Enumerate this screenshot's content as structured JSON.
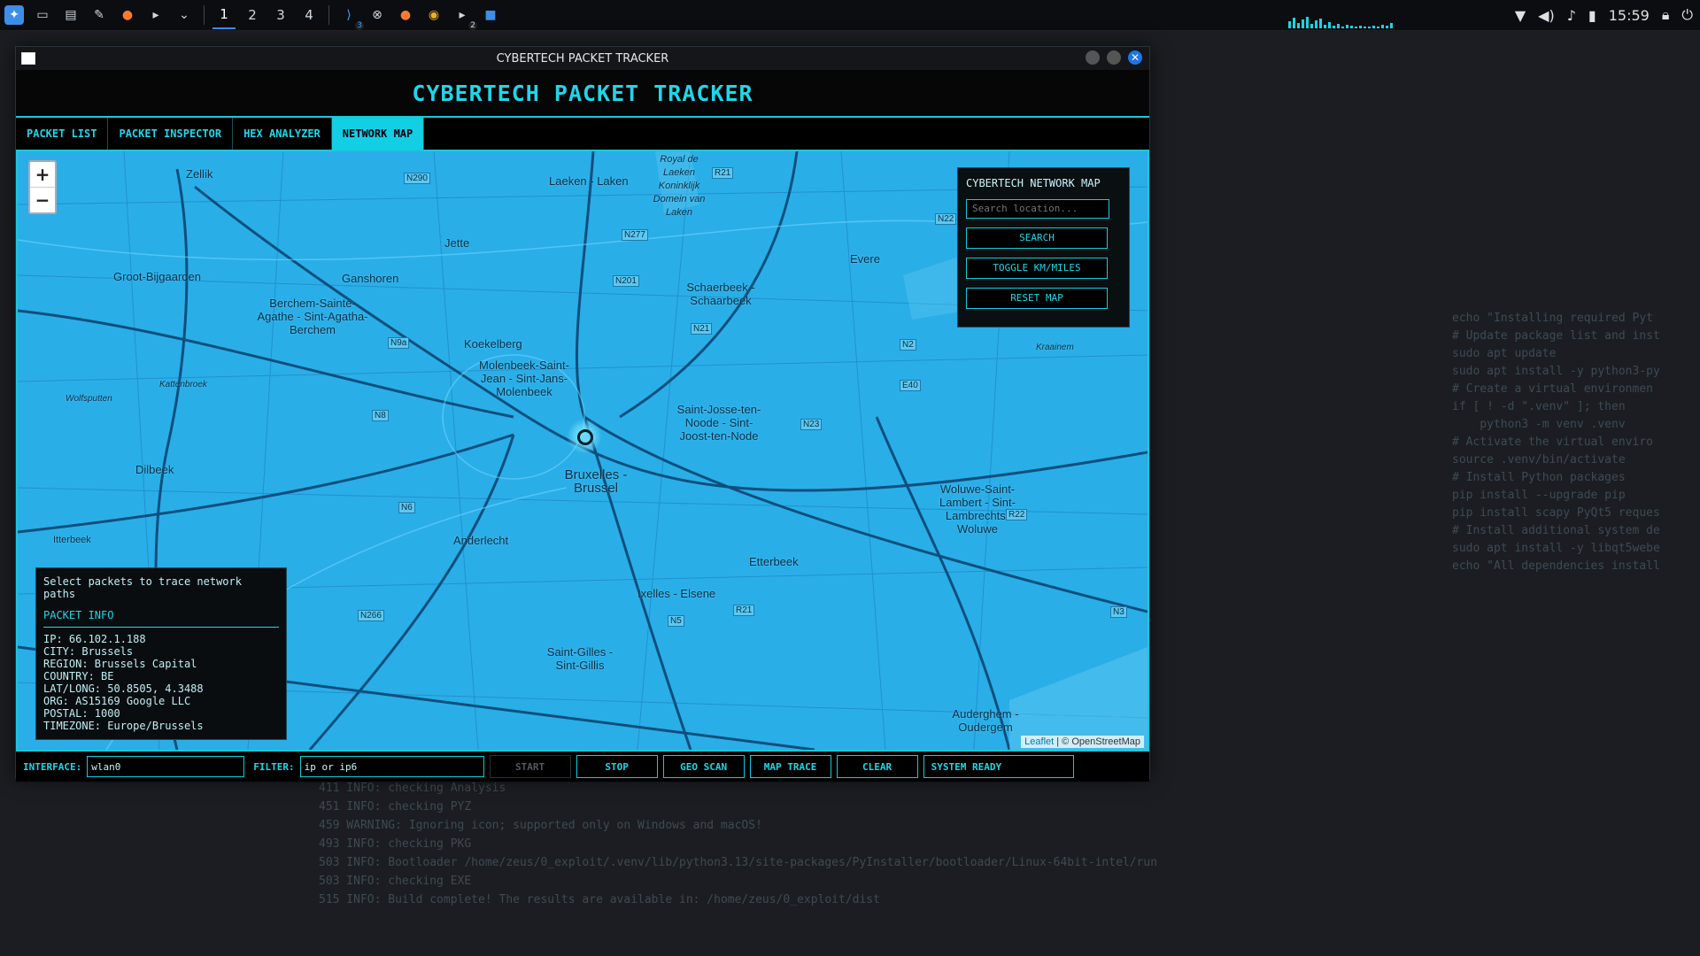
{
  "taskbar": {
    "workspaces": [
      "1",
      "2",
      "3",
      "4"
    ],
    "clock": "15:59",
    "badges": {
      "vscode": "3",
      "terminal": "2"
    }
  },
  "window": {
    "title": "CYBERTECH PACKET TRACKER",
    "app_title": "CYBERTECH PACKET TRACKER",
    "tabs": [
      "PACKET LIST",
      "PACKET INSPECTOR",
      "HEX ANALYZER",
      "NETWORK MAP"
    ],
    "active_tab": "NETWORK MAP"
  },
  "map": {
    "zoom_in": "+",
    "zoom_out": "−",
    "labels": [
      "Zellik",
      "Laeken - Laken",
      "Royal de Laeken Koninklijk Domein van Laken",
      "Jette",
      "Groot-Bijgaarden",
      "Ganshoren",
      "Berchem-Sainte-Agathe - Sint-Agatha-Berchem",
      "Koekelberg",
      "Schaerbeek - Schaarbeek",
      "Evere",
      "Molenbeek-Saint-Jean - Sint-Jans-Molenbeek",
      "Bruxelles - Brussel",
      "Saint-Josse-ten-Noode - Sint-Joost-ten-Node",
      "Dilbeek",
      "Anderlecht",
      "Woluwe-Saint-Lambert - Sint-Lambrechts-Woluwe",
      "Etterbeek",
      "Ixelles - Elsene",
      "Saint-Gilles - Sint-Gillis",
      "Auderghem - Oudergem",
      "Itterbeek",
      "Kattenbroek",
      "Wolfsputten",
      "Kraainem"
    ],
    "roads": [
      "N290",
      "R21",
      "N277",
      "N22",
      "N201",
      "N21",
      "N9a",
      "N2",
      "E40",
      "N8",
      "N23",
      "N6",
      "R22",
      "N266",
      "N5",
      "R21",
      "N3"
    ],
    "attribution_leaflet": "Leaflet",
    "attribution_osm": "| © OpenStreetMap"
  },
  "network_panel": {
    "title": "CYBERTECH NETWORK MAP",
    "search_placeholder": "Search location...",
    "search_btn": "SEARCH",
    "toggle_btn": "TOGGLE KM/MILES",
    "reset_btn": "RESET MAP"
  },
  "info_panel": {
    "hint": "Select packets to trace network paths",
    "header": "PACKET INFO",
    "lines": [
      "IP: 66.102.1.188",
      "CITY: Brussels",
      "REGION: Brussels Capital",
      "COUNTRY: BE",
      "LAT/LONG: 50.8505, 4.3488",
      "ORG: AS15169 Google LLC",
      "POSTAL: 1000",
      "TIMEZONE: Europe/Brussels"
    ]
  },
  "statusbar": {
    "interface_label": "INTERFACE:",
    "interface_value": "wlan0",
    "filter_label": "FILTER:",
    "filter_value": "ip or ip6",
    "start": "START",
    "stop": "STOP",
    "geo_scan": "GEO SCAN",
    "map_trace": "MAP TRACE",
    "clear": "CLEAR",
    "status": "SYSTEM READY"
  },
  "background": {
    "terminal_lines": [
      "411 INFO: checking Analysis",
      "451 INFO: checking PYZ",
      "459 WARNING: Ignoring icon; supported only on Windows and macOS!",
      "493 INFO: checking PKG",
      "503 INFO: Bootloader /home/zeus/0_exploit/.venv/lib/python3.13/site-packages/PyInstaller/bootloader/Linux-64bit-intel/run",
      "503 INFO: checking EXE",
      "515 INFO: Build complete! The results are available in: /home/zeus/0_exploit/dist"
    ],
    "code_lines": [
      "echo \"Installing required Pyt",
      "",
      "# Update package list and inst",
      "sudo apt update",
      "sudo apt install -y python3-py",
      "",
      "# Create a virtual environmen",
      "if [ ! -d \".venv\" ]; then",
      "    python3 -m venv .venv",
      "",
      "# Activate the virtual enviro",
      "source .venv/bin/activate",
      "",
      "# Install Python packages",
      "pip install --upgrade pip",
      "pip install scapy PyQt5 reques",
      "",
      "# Install additional system de",
      "sudo apt install -y libqt5webe",
      "",
      "echo \"All dependencies install"
    ]
  }
}
